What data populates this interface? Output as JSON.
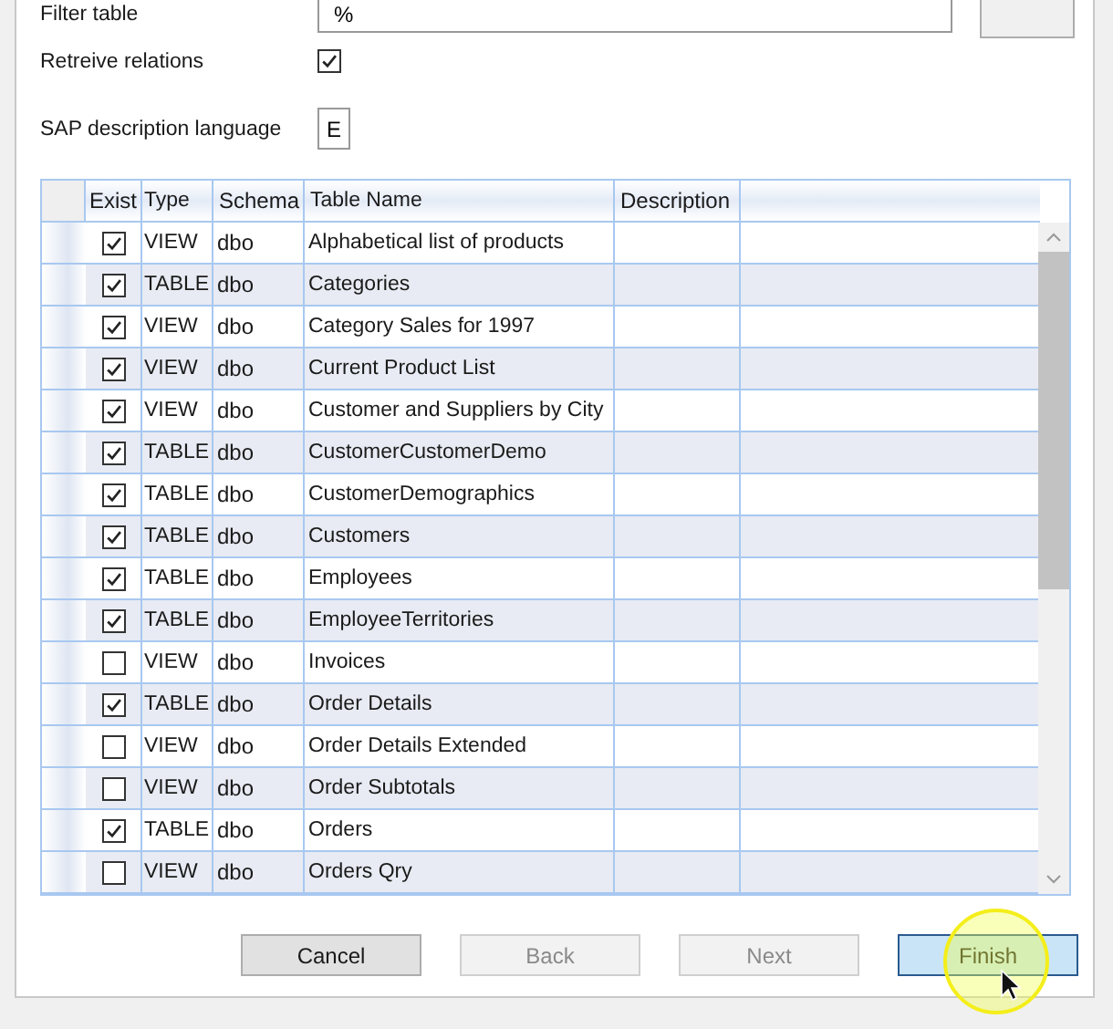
{
  "filter": {
    "label": "Filter table",
    "value": "%"
  },
  "retrieve_relations": {
    "label": "Retreive relations",
    "checked": true
  },
  "sap_language": {
    "label": "SAP description language",
    "value": "E"
  },
  "table": {
    "columns": [
      "Exist",
      "Type",
      "Schema",
      "Table Name",
      "Description"
    ],
    "rows": [
      {
        "exist": true,
        "type": "VIEW",
        "schema": "dbo",
        "name": "Alphabetical list of products"
      },
      {
        "exist": true,
        "type": "TABLE",
        "schema": "dbo",
        "name": "Categories"
      },
      {
        "exist": true,
        "type": "VIEW",
        "schema": "dbo",
        "name": "Category Sales for 1997"
      },
      {
        "exist": true,
        "type": "VIEW",
        "schema": "dbo",
        "name": "Current Product List"
      },
      {
        "exist": true,
        "type": "VIEW",
        "schema": "dbo",
        "name": "Customer and Suppliers by City"
      },
      {
        "exist": true,
        "type": "TABLE",
        "schema": "dbo",
        "name": "CustomerCustomerDemo"
      },
      {
        "exist": true,
        "type": "TABLE",
        "schema": "dbo",
        "name": "CustomerDemographics"
      },
      {
        "exist": true,
        "type": "TABLE",
        "schema": "dbo",
        "name": "Customers"
      },
      {
        "exist": true,
        "type": "TABLE",
        "schema": "dbo",
        "name": "Employees"
      },
      {
        "exist": true,
        "type": "TABLE",
        "schema": "dbo",
        "name": "EmployeeTerritories"
      },
      {
        "exist": false,
        "type": "VIEW",
        "schema": "dbo",
        "name": "Invoices"
      },
      {
        "exist": true,
        "type": "TABLE",
        "schema": "dbo",
        "name": "Order Details"
      },
      {
        "exist": false,
        "type": "VIEW",
        "schema": "dbo",
        "name": "Order Details Extended"
      },
      {
        "exist": false,
        "type": "VIEW",
        "schema": "dbo",
        "name": "Order Subtotals"
      },
      {
        "exist": true,
        "type": "TABLE",
        "schema": "dbo",
        "name": "Orders"
      },
      {
        "exist": false,
        "type": "VIEW",
        "schema": "dbo",
        "name": "Orders Qry"
      }
    ]
  },
  "buttons": [
    {
      "label": "Cancel",
      "disabled": false,
      "selected": false
    },
    {
      "label": "Back",
      "disabled": true,
      "selected": false
    },
    {
      "label": "Next",
      "disabled": true,
      "selected": false
    },
    {
      "label": "Finish",
      "disabled": false,
      "selected": true
    }
  ]
}
